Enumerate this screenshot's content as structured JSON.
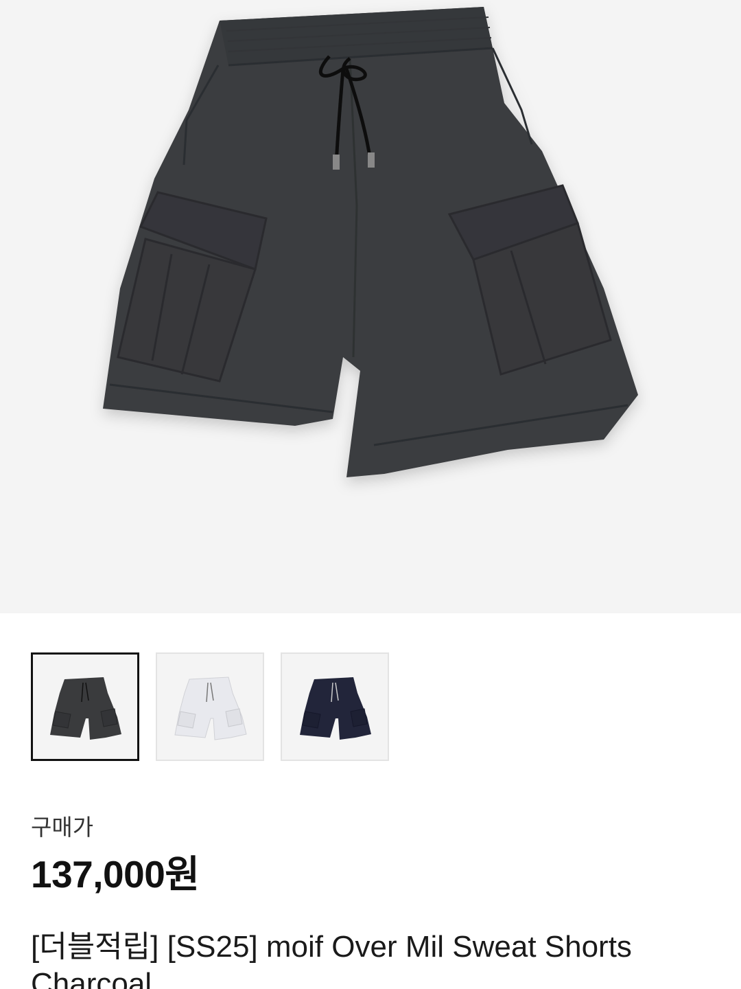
{
  "product": {
    "main_image": {
      "icon": "charcoal-cargo-shorts-image",
      "color": "#3a3b3d"
    },
    "thumbnails": [
      {
        "icon": "charcoal-shorts-thumbnail",
        "color": "#3a3b3d",
        "selected": true
      },
      {
        "icon": "white-shorts-thumbnail",
        "color": "#e8e9ee",
        "selected": false
      },
      {
        "icon": "navy-shorts-thumbnail",
        "color": "#22253a",
        "selected": false
      }
    ],
    "price_label": "구매가",
    "price": "137,000원",
    "title": "[더블적립] [SS25] moif Over Mil Sweat Shorts Charcoal"
  }
}
